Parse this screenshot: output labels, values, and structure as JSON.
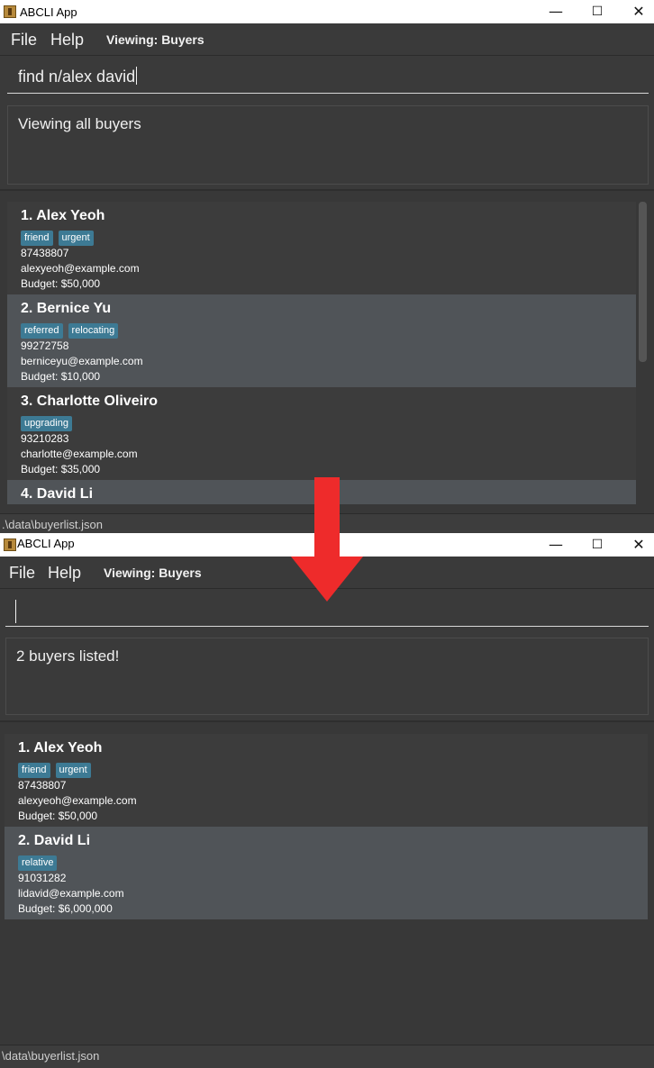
{
  "app": {
    "title": "ABCLI App"
  },
  "menu": {
    "file": "File",
    "help": "Help",
    "viewing": "Viewing: Buyers"
  },
  "window_controls": {
    "minimize": "—",
    "maximize": "☐",
    "close": "✕"
  },
  "before": {
    "command_input": "find n/alex david",
    "result": "Viewing all buyers",
    "buyers": [
      {
        "name": "1. Alex Yeoh",
        "tags": [
          "friend",
          "urgent"
        ],
        "phone": "87438807",
        "email": "alexyeoh@example.com",
        "budget": "Budget: $50,000"
      },
      {
        "name": "2. Bernice Yu",
        "tags": [
          "referred",
          "relocating"
        ],
        "phone": "99272758",
        "email": "berniceyu@example.com",
        "budget": "Budget: $10,000"
      },
      {
        "name": "3. Charlotte Oliveiro",
        "tags": [
          "upgrading"
        ],
        "phone": "93210283",
        "email": "charlotte@example.com",
        "budget": "Budget: $35,000"
      },
      {
        "name": "4. David Li"
      }
    ],
    "status": ".\\data\\buyerlist.json"
  },
  "after": {
    "command_input": "",
    "result": "2 buyers listed!",
    "buyers": [
      {
        "name": "1. Alex Yeoh",
        "tags": [
          "friend",
          "urgent"
        ],
        "phone": "87438807",
        "email": "alexyeoh@example.com",
        "budget": "Budget: $50,000"
      },
      {
        "name": "2. David Li",
        "tags": [
          "relative"
        ],
        "phone": "91031282",
        "email": "lidavid@example.com",
        "budget": "Budget: $6,000,000"
      }
    ],
    "status": "\\data\\buyerlist.json"
  },
  "colors": {
    "arrow": "#ee2b2b",
    "tag": "#3d7a94",
    "card_alt": "#505458"
  }
}
